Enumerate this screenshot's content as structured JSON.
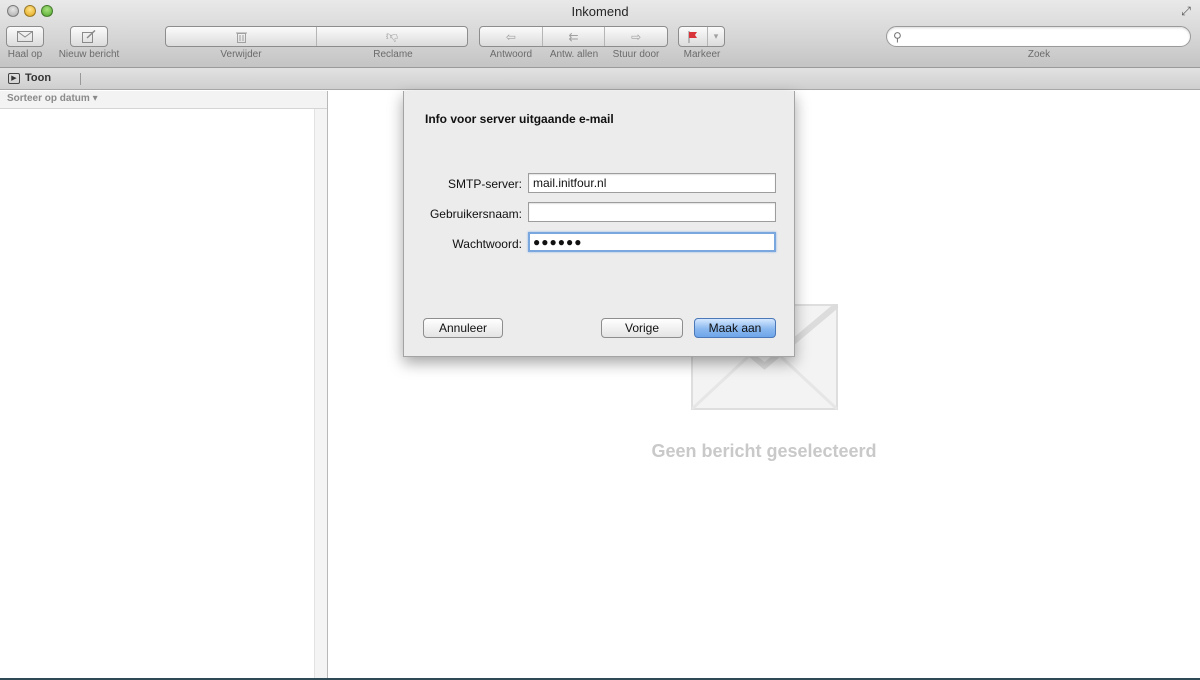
{
  "window": {
    "title": "Inkomend"
  },
  "toolbar": {
    "get_mail": "Haal op",
    "new_message": "Nieuw bericht",
    "delete": "Verwijder",
    "junk": "Reclame",
    "reply": "Antwoord",
    "reply_all": "Antw. allen",
    "forward": "Stuur door",
    "flag": "Markeer",
    "search_label": "Zoek",
    "search_value": ""
  },
  "filterbar": {
    "show_label": "Toon"
  },
  "message_list": {
    "sort_label": "Sorteer op datum ▾"
  },
  "viewer": {
    "no_message": "Geen bericht geselecteerd"
  },
  "dialog": {
    "title": "Info voor server uitgaande e-mail",
    "smtp_label": "SMTP-server:",
    "smtp_value": "mail.initfour.nl",
    "username_label": "Gebruikersnaam:",
    "username_value": "",
    "password_label": "Wachtwoord:",
    "password_masked": "●●●●●●",
    "cancel": "Annuleer",
    "back": "Vorige",
    "create": "Maak aan"
  },
  "icons": {
    "get_mail": "envelope-icon",
    "new_message": "compose-icon",
    "delete": "trash-icon",
    "junk": "thumbs-down-icon",
    "reply": "reply-arrow-icon",
    "reply_all": "reply-all-arrow-icon",
    "forward": "forward-arrow-icon",
    "flag": "flag-icon",
    "search": "magnifier-icon"
  },
  "colors": {
    "default_button": "#6ea5ea",
    "flag": "#d8343a"
  }
}
